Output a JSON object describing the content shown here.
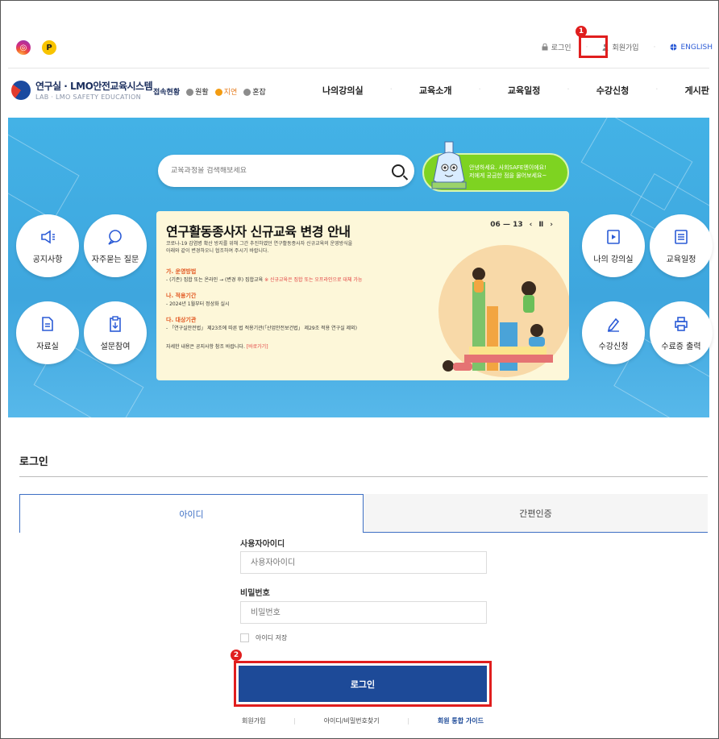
{
  "sns": {
    "instagram": "◎",
    "post": "P"
  },
  "util": {
    "login": "로그인",
    "signup": "회원가입",
    "english": "ENGLISH"
  },
  "markers": {
    "one": "1",
    "two": "2"
  },
  "logo": {
    "title": "연구실 · LMO안전교육시스템",
    "subtitle": "LAB · LMO SAFETY EDUCATION"
  },
  "status": {
    "label": "접속현황",
    "items": [
      {
        "label": "원활",
        "color": "#8c8c8c"
      },
      {
        "label": "지연",
        "color": "#f39c12"
      },
      {
        "label": "혼잡",
        "color": "#8c8c8c"
      }
    ]
  },
  "nav": [
    "나의강의실",
    "교육소개",
    "교육일정",
    "수강신청",
    "게시판"
  ],
  "search": {
    "placeholder": "교육과정을 검색해보세요"
  },
  "promo": {
    "line1": "안녕하세요. 사회SAFE엔이에요!",
    "line2": "저에게 궁금한 점을 물어보세요~"
  },
  "quick_left": [
    "공지사항",
    "자주묻는 질문",
    "자료실",
    "설문참여"
  ],
  "quick_right": [
    "나의 강의실",
    "교육일정",
    "수강신청",
    "수료증 출력"
  ],
  "notice": {
    "title": "연구활동종사자 신규교육 변경 안내",
    "pager": "06 — 13",
    "prev": "‹",
    "pause": "Ⅱ",
    "next": "›",
    "sub1": "코로나-19 감염병 확산 방지를 위해 그간 추진하였던 연구활동종사자 신규교육의 운영방식을",
    "sub2": "아래와 같이 변경하오니 협조하여 주시기 바랍니다.",
    "h1": "가. 운영방법",
    "b1": "- (기존) 집합 또는 온라인 → (변경 후) 집합교육",
    "b1red": "※ 신규교육은 집합 또는 오프라인으로 대체 가능",
    "h2": "나. 적용기간",
    "b2": "- 2024년 1월부터 정상화 실시",
    "h3": "다. 대상기관",
    "b3": "- 「연구실안전법」 제23조에 따른 법 적용기관(「산업안전보건법」 제29조 적용 연구실 제외)",
    "b4": "자세한 내용은 공지사항 참조 바랍니다.",
    "b4link": "[바로가기]"
  },
  "login": {
    "title": "로그인",
    "tab_id": "아이디",
    "tab_easy": "간편인증",
    "id_label": "사용자아이디",
    "id_placeholder": "사용자아이디",
    "pw_label": "비밀번호",
    "pw_placeholder": "비밀번호",
    "remember": "아이디 저장",
    "button": "로그인"
  },
  "bottom_links": {
    "signup": "회원가입",
    "find": "아이디/비밀번호찾기",
    "guide": "회원 통합 가이드"
  },
  "colors": {
    "primary": "#1d4a98",
    "hero": "#43b2e6",
    "highlight": "#e01e1e",
    "promo": "#7ed321"
  }
}
